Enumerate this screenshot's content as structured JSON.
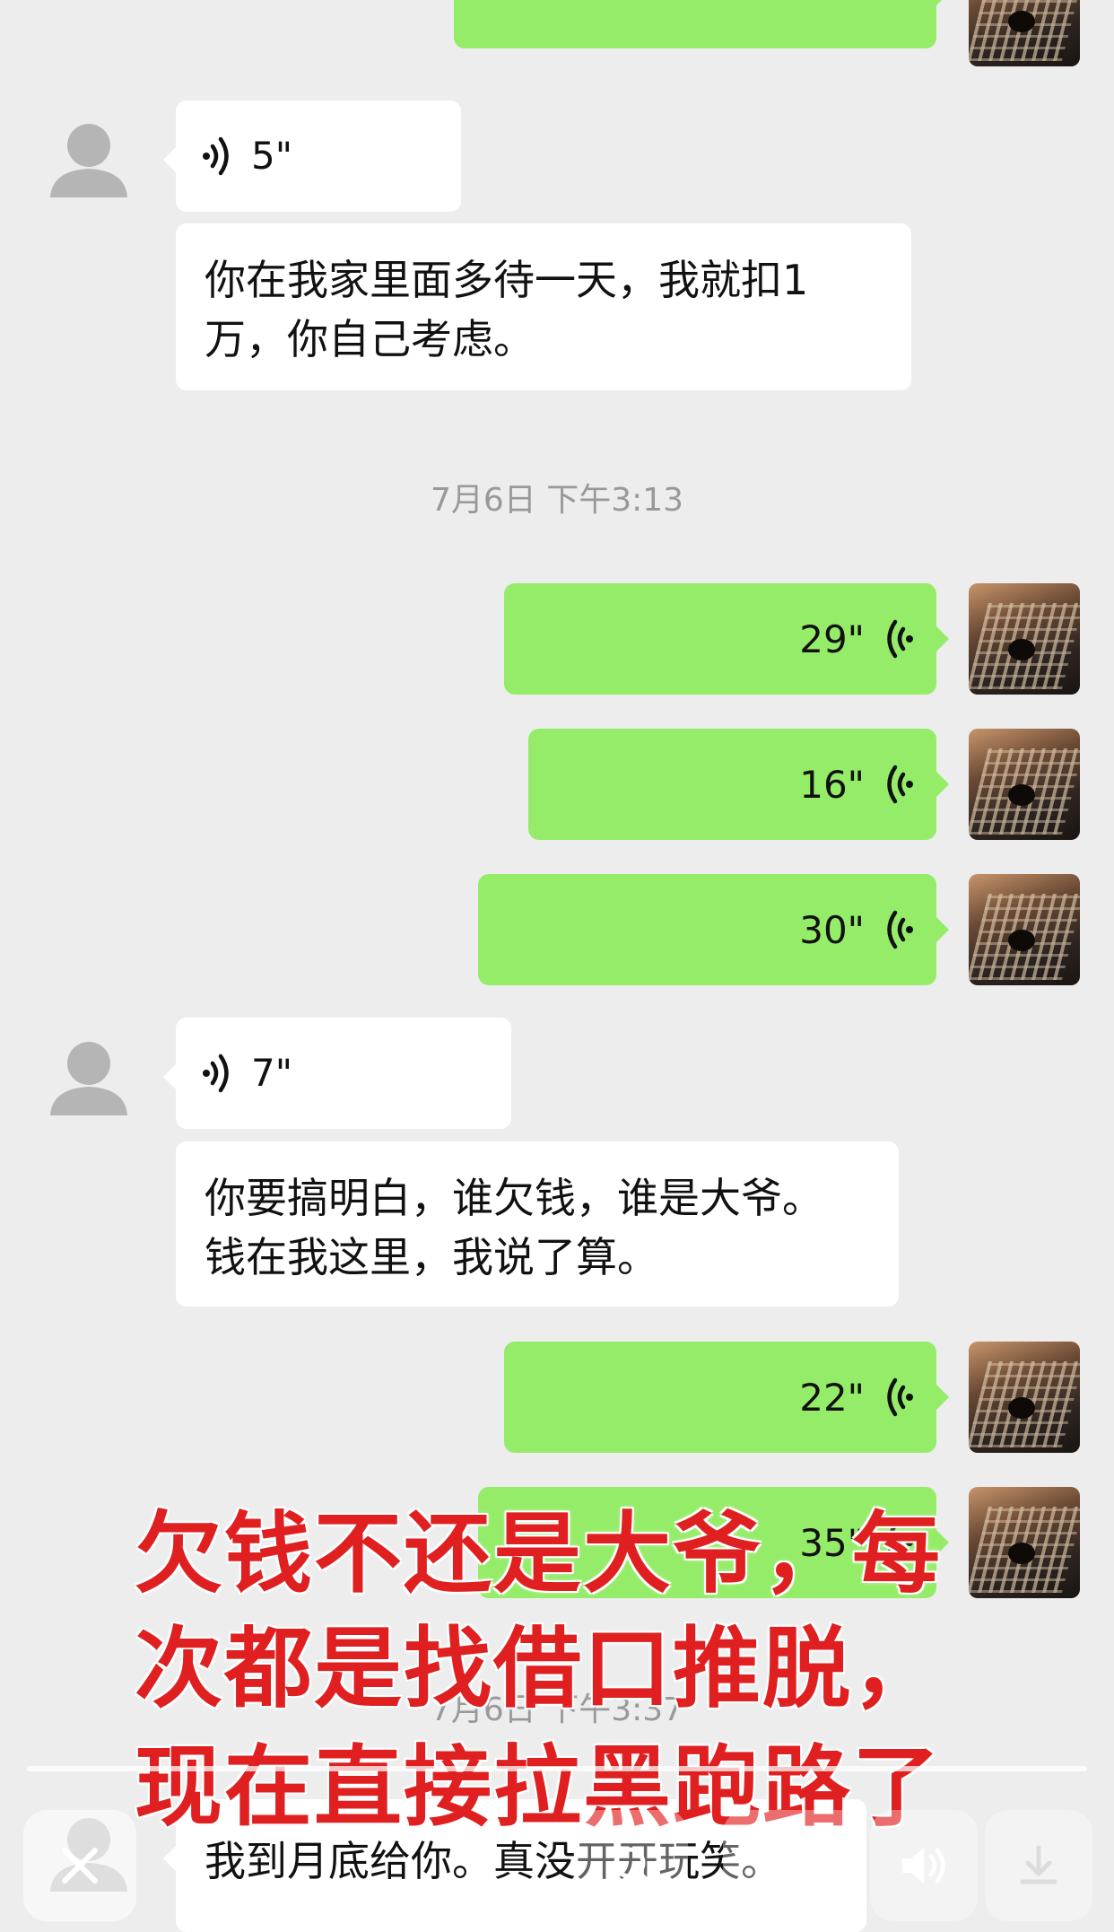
{
  "colors": {
    "background": "#ededed",
    "bubble_incoming": "#ffffff",
    "bubble_outgoing": "#95ec69",
    "overlay_text": "#e02020",
    "timestamp": "#999999"
  },
  "messages": [
    {
      "side": "out",
      "type": "voice",
      "partial": true
    },
    {
      "side": "in",
      "type": "voice",
      "duration": "5\""
    },
    {
      "side": "in",
      "type": "text",
      "lines": [
        "你在我家里面多待一天，我就扣1",
        "万，你自己考虑。"
      ]
    },
    {
      "type": "timestamp",
      "text": "7月6日 下午3:13"
    },
    {
      "side": "out",
      "type": "voice",
      "duration": "29\""
    },
    {
      "side": "out",
      "type": "voice",
      "duration": "16\""
    },
    {
      "side": "out",
      "type": "voice",
      "duration": "30\""
    },
    {
      "side": "in",
      "type": "voice",
      "duration": "7\""
    },
    {
      "side": "in",
      "type": "text",
      "lines": [
        "你要搞明白，谁欠钱，谁是大爷。",
        "钱在我这里，我说了算。"
      ]
    },
    {
      "side": "out",
      "type": "voice",
      "duration": "22\""
    },
    {
      "side": "out",
      "type": "voice",
      "duration": "35\""
    },
    {
      "type": "timestamp",
      "text": "7月6日 下午3:37"
    },
    {
      "side": "in",
      "type": "text",
      "lines": [
        "我到月底给你。真没开开玩笑。"
      ]
    }
  ],
  "overlay": {
    "lines": [
      "欠钱不还是大爷，每",
      "次都是找借口推脱，",
      "现在直接拉黑跑路了"
    ]
  },
  "player": {
    "progress": 0.0,
    "icons": [
      "close-icon",
      "search-icon",
      "menu-icon",
      "volume-icon",
      "download-icon"
    ]
  }
}
